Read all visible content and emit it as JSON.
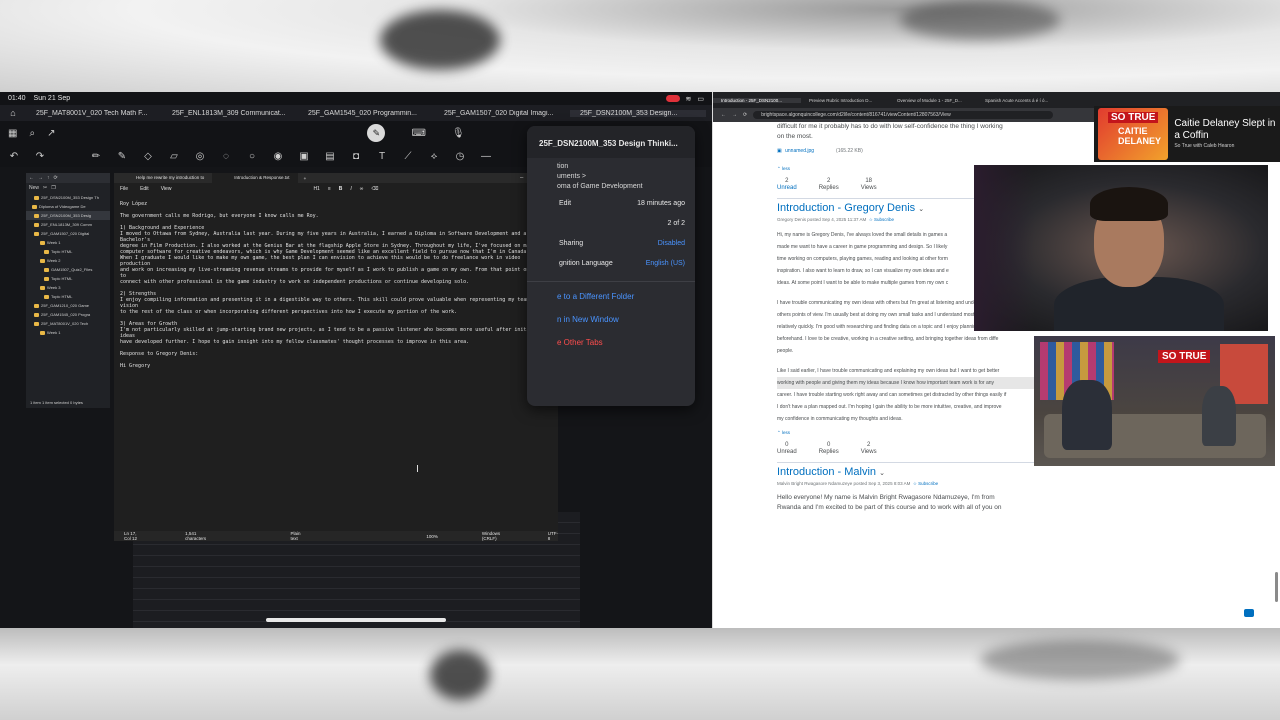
{
  "ipad": {
    "time": "01:40",
    "date": "Sun 21 Sep",
    "tabs": [
      {
        "label": "25F_MAT8001V_020 Tech Math F..."
      },
      {
        "label": "25F_ENL1813M_309 Communicat..."
      },
      {
        "label": "25F_GAM1545_020 Programmin..."
      },
      {
        "label": "25F_GAM1507_020 Digital Imagi..."
      },
      {
        "label": "25F_DSN2100M_353 Design..."
      }
    ]
  },
  "explorer": {
    "new_label": "New",
    "rows": [
      "25F_DSN2100M_353 Design Th",
      "Diploma of Videogame De",
      "25F_DSN2100M_353 Desig",
      "25F_ENL1813M_309 Comm",
      "25F_GAM1507_020 Digital",
      "Week 1",
      "Topic HTML",
      "Week 2",
      "GAM1507_Quiz2_Files",
      "Topic HTML",
      "Week 3",
      "Topic HTML",
      "25F_GAM1210_020 Game",
      "25F_GAM1545_020 Progra",
      "25F_MAT8001V_020 Tech",
      "Week 1"
    ],
    "status": "1 item  1 item selected 0 bytes"
  },
  "notepad": {
    "tabs": [
      "Help me rewrite my introduction to",
      "Introduction & Response.txt"
    ],
    "menu": [
      "File",
      "Edit",
      "View"
    ],
    "heading_select": "H1",
    "body": "Roy López\n\nThe government calls me Rodrigo, but everyone I know calls me Roy.\n\n1) Background and Experience\nI moved to Ottawa from Sydney, Australia last year. During my five years in Australia, I earned a Diploma in Software Development and a Bachelor's\ndegree in Film Production. I also worked at the Genius Bar at the flagship Apple Store in Sydney. Throughout my life, I've focused on mastering\ncomputer software for creative endeavors, which is why Game Development seemed like an excellent field to pursue now that I'm in Canada.\nWhen I graduate I would like to make my own game, the best plan I can envision to achieve this would be to do freelance work in video production\nand work on increasing my live-streaming revenue streams to provide for myself as I work to publish a game on my own. From that point on I hope to\nconnect with other professional in the game industry to work on independent productions or continue developing solo.\n\n2) Strengths\nI enjoy compiling information and presenting it in a digestible way to others. This skill could prove valuable when representing my team's vision\nto the rest of the class or when incorporating different perspectives into how I execute my portion of the work.\n\n3) Areas for Growth\nI'm not particularly skilled at jump-starting brand new projects, as I tend to be a passive listener who becomes more useful after initial ideas\nhave developed further. I hope to gain insight into my fellow classmates' thought processes to improve in this area.\n\nResponse to Gregory Denis:\n\nHi Gregory",
    "status": {
      "pos": "Ln 17, Col 12",
      "chars": "1,541 characters",
      "fmt": "Plain text",
      "zoom": "100%",
      "eol": "Windows (CRLF)",
      "enc": "UTF-8"
    }
  },
  "popover": {
    "title": "25F_DSN2100M_353 Design Thinki...",
    "location_label": "tion",
    "path1": "uments >",
    "path2": "oma of Game Development",
    "edit_label": "Edit",
    "edit_value": "18 minutes ago",
    "page_value": "2 of 2",
    "sharing_label": "Sharing",
    "sharing_value": "Disabled",
    "lang_label": "gnition Language",
    "lang_value": "English (US)",
    "actions": [
      "e to a Different Folder",
      "n in New Window",
      "e Other Tabs"
    ]
  },
  "browser": {
    "tabs": [
      "Introduction - 25F_DSN2100...",
      "Preview Rubric Introduction D...",
      "Overview of Module 1 - 25F_D...",
      "Spanish Acute Accents á é í ó..."
    ],
    "url": "brightspace.algonquincollege.com/d2l/le/content/816741/viewContent/12807563/View"
  },
  "page": {
    "top_text_1": "difficult for me it probably has to do with low self-confidence the thing I working",
    "top_text_2": "on the most.",
    "attachment": "unnamed.jpg",
    "attachment_size": "(165.22 KB)",
    "less": "less",
    "stats1": [
      {
        "n": "2",
        "l": "Unread"
      },
      {
        "n": "2",
        "l": "Replies"
      },
      {
        "n": "18",
        "l": "Views"
      }
    ],
    "post1_title": "Introduction - Gregory Denis",
    "post1_meta": "Gregory Denis posted Sep 4, 2025 11:37 AM",
    "subscribe": "Subscribe",
    "post1_lines": [
      "Hi, my name is Gregory Denis, I've always loved the small details in games a",
      "made me want to have a career in game programming and design. So I likely",
      "time working on computers, playing games, reading and looking at other form",
      "inspiration. I also want to learn to draw, so I can visualize my own ideas and e",
      "ideas. At some point I want to be able to make multiple games from my own c",
      "I have trouble communicating my own ideas with others but I'm great at listening and understanding",
      "others points of view. I'm usually best at doing my own small tasks and I understand most things",
      "relatively quickly. I'm good with researching and finding data on a topic and I enjoy planning things ou",
      "beforehand. I love to be creative, working in a creative setting, and bringing together ideas from diffe",
      "people.",
      "Like I said earlier, I have trouble communicating and explaining my own ideas but I want to get better",
      "working with people and giving them my ideas because I know how important team work is for any",
      "career. I have trouble starting work right away and can sometimes get distracted by other things easily if",
      "I don't have a plan mapped out. I'm hoping I gain the ability to be more intuitive, creative, and improve",
      "my confidence in communicating my thoughts and ideas."
    ],
    "stats2": [
      {
        "n": "0",
        "l": "Unread"
      },
      {
        "n": "0",
        "l": "Replies"
      },
      {
        "n": "2",
        "l": "Views"
      }
    ],
    "post2_title": "Introduction - Malvin",
    "post2_meta": "Malvin Bright Rwagasore Ndamuzeye posted Sep 3, 2025 8:03 AM",
    "post2_text_1": "Hello everyone! My name is Malvin Bright Rwagasore Ndamuzeye, I'm from",
    "post2_text_2": "Rwanda and I'm excited to be part of this course and to work with all of you on"
  },
  "ad": {
    "badge": "SO TRUE",
    "name_line1": "CAITIE",
    "name_line2": "DELANEY",
    "title": "Caitie Delaney Slept in a Coffin",
    "subtitle": "So True with Caleb Hearon"
  },
  "video": {
    "sign": "SO TRUE"
  }
}
